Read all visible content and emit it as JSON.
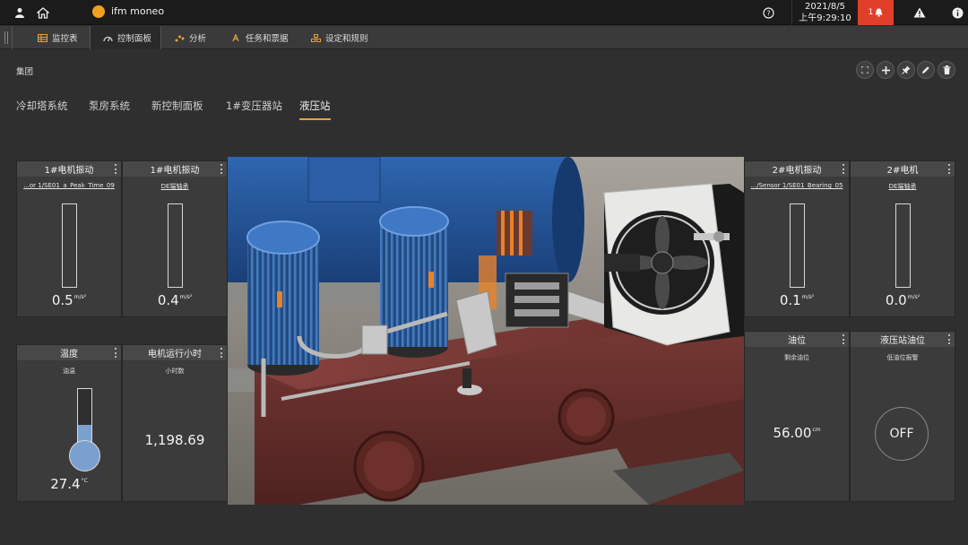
{
  "app": {
    "name": "ifm moneo",
    "date": "2021/8/5",
    "time": "上午9:29:10",
    "alarm_count": "1"
  },
  "nav": {
    "tabs": [
      {
        "label": "监控表",
        "icon": "table-icon"
      },
      {
        "label": "控制面板",
        "icon": "gauge-icon"
      },
      {
        "label": "分析",
        "icon": "analysis-icon"
      },
      {
        "label": "任务和票据",
        "icon": "tasks-icon"
      },
      {
        "label": "设定和规则",
        "icon": "rules-icon"
      }
    ],
    "active_index": 1
  },
  "group": {
    "label": "集团"
  },
  "dashboards": {
    "tabs": [
      "冷却塔系统",
      "泵房系统",
      "新控制面板",
      "1#变压器站",
      "液压站"
    ],
    "active_index": 4
  },
  "widgets": {
    "w1": {
      "title": "1#电机振动",
      "link": "...or 1/SE01_a_Peak_Time_09",
      "value": "0.5",
      "unit": "m/s²",
      "level": 0.0
    },
    "w2": {
      "title": "1#电机振动",
      "link": "DE端轴承",
      "value": "0.4",
      "unit": "m/s²",
      "level": 0.0
    },
    "w3": {
      "title": "2#电机振动",
      "link": ".../Sensor 1/SE01_Bearing_05",
      "value": "0.1",
      "unit": "m/s²",
      "level": 0.0
    },
    "w4": {
      "title": "2#电机",
      "link": "DE端轴承",
      "value": "0.0",
      "unit": "m/s²",
      "level": 0.0
    },
    "temp": {
      "title": "温度",
      "sub": "油温",
      "value": "27.4",
      "unit": "°C",
      "level": 0.45
    },
    "hours": {
      "title": "电机运行小时",
      "sub": "小时数",
      "value": "1,198.69"
    },
    "oil": {
      "title": "油位",
      "sub": "剩余油位",
      "value": "56.00",
      "unit": "cm"
    },
    "oil_alarm": {
      "title": "液压站油位",
      "sub": "低油位报警",
      "state": "OFF"
    }
  },
  "colors": {
    "accent": "#e8a23c",
    "alarm": "#e0402a",
    "gauge_fill": "#7aa0d0",
    "logo": "#f0a020"
  }
}
